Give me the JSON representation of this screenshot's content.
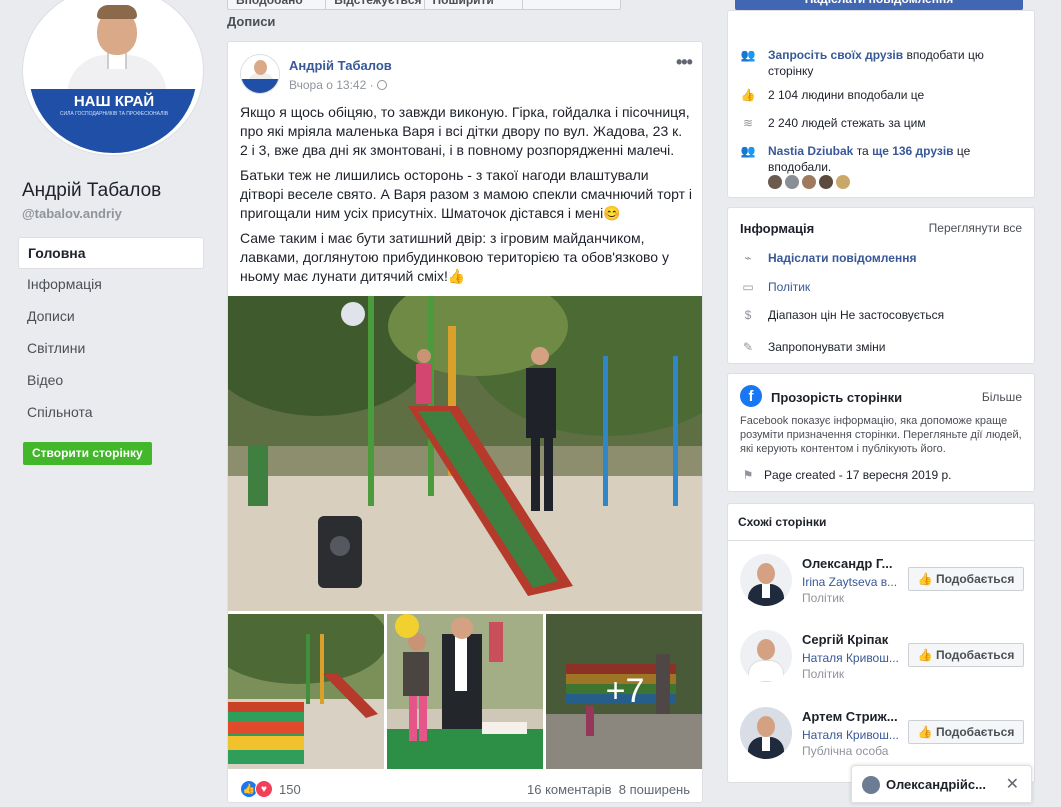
{
  "page": {
    "name": "Андрій Табалов",
    "handle": "@tabalov.andriy",
    "avatar_logo": "НАШ КРАЙ",
    "avatar_subtitle": "СИЛА ГОСПОДАРНИКІВ ТА ПРОФЕСІОНАЛІВ"
  },
  "nav": {
    "items": [
      "Головна",
      "Інформація",
      "Дописи",
      "Світлини",
      "Відео",
      "Спільнота"
    ],
    "active": "Головна",
    "create_button": "Створити сторінку"
  },
  "topbar": {
    "buttons": [
      "Вподобано",
      "Відстежується",
      "Поширити",
      ""
    ],
    "message_button": "Надіслати повідомлення"
  },
  "posts_heading": "Дописи",
  "post": {
    "author": "Андрій Табалов",
    "time": "Вчора о 13:42 ·",
    "paragraphs": [
      "Якщо я щось обіцяю, то завжди виконую. Гірка, гойдалка і пісочниця, про які мріяла маленька Варя і всі дітки двору по вул. Жадова, 23 к. 2 і 3, вже два дні як змонтовані, і в повному розпорядженні малечі.",
      "Батьки теж не лишились осторонь - з такої нагоди влаштували дітворі веселе свято. А Варя разом з мамою спекли смачнючий торт і пригощали ним усіх присутніх. Шматочок дістався і мені😊",
      "Саме таким і має бути затишний двір: з ігровим майданчиком, лавками, доглянутою прибудинковою територією та обов'язково у ньому має лунати дитячий сміх!👍"
    ],
    "more_photos": "+7",
    "reaction_count": "150",
    "comments": "16 коментарів",
    "shares": "8 поширень"
  },
  "community": {
    "invite_link": "Запросіть своїх друзів",
    "invite_rest": " вподобати цю сторінку",
    "likes": "2 104 людини вподобали це",
    "follows": "2 240 людей стежать за цим",
    "friend_name": "Nastia Dziubak",
    "friend_mid": " та ",
    "friend_count": "ще 136 друзів",
    "friend_rest": " це вподобали."
  },
  "info": {
    "title": "Інформація",
    "see_all": "Переглянути все",
    "send_message": "Надіслати повідомлення",
    "category": "Політик",
    "price": "Діапазон цін Не застосовується",
    "suggest": "Запропонувати зміни"
  },
  "transparency": {
    "title": "Прозорість сторінки",
    "more": "Більше",
    "description": "Facebook показує інформацію, яка допоможе краще розуміти призначення сторінки. Перегляньте дії людей, які керують контентом і публікують його.",
    "created": "Page created - 17 вересня 2019 р."
  },
  "similar": {
    "title": "Схожі сторінки",
    "like_label": "Подобається",
    "pages": [
      {
        "name": "Олександр Г...",
        "sub": "Irina Zaytseva в...",
        "cat": "Політик"
      },
      {
        "name": "Сергій Кріпак",
        "sub": "Наталя Кривош...",
        "cat": "Політик"
      },
      {
        "name": "Артем Стриж...",
        "sub": "Наталя Кривош...",
        "cat": "Публічна особа"
      }
    ]
  },
  "chat": {
    "name": "Олександрійс..."
  },
  "colors": {
    "fb_blue": "#4267b2",
    "link": "#385898",
    "green": "#42b72a",
    "bg": "#e9ebee"
  }
}
